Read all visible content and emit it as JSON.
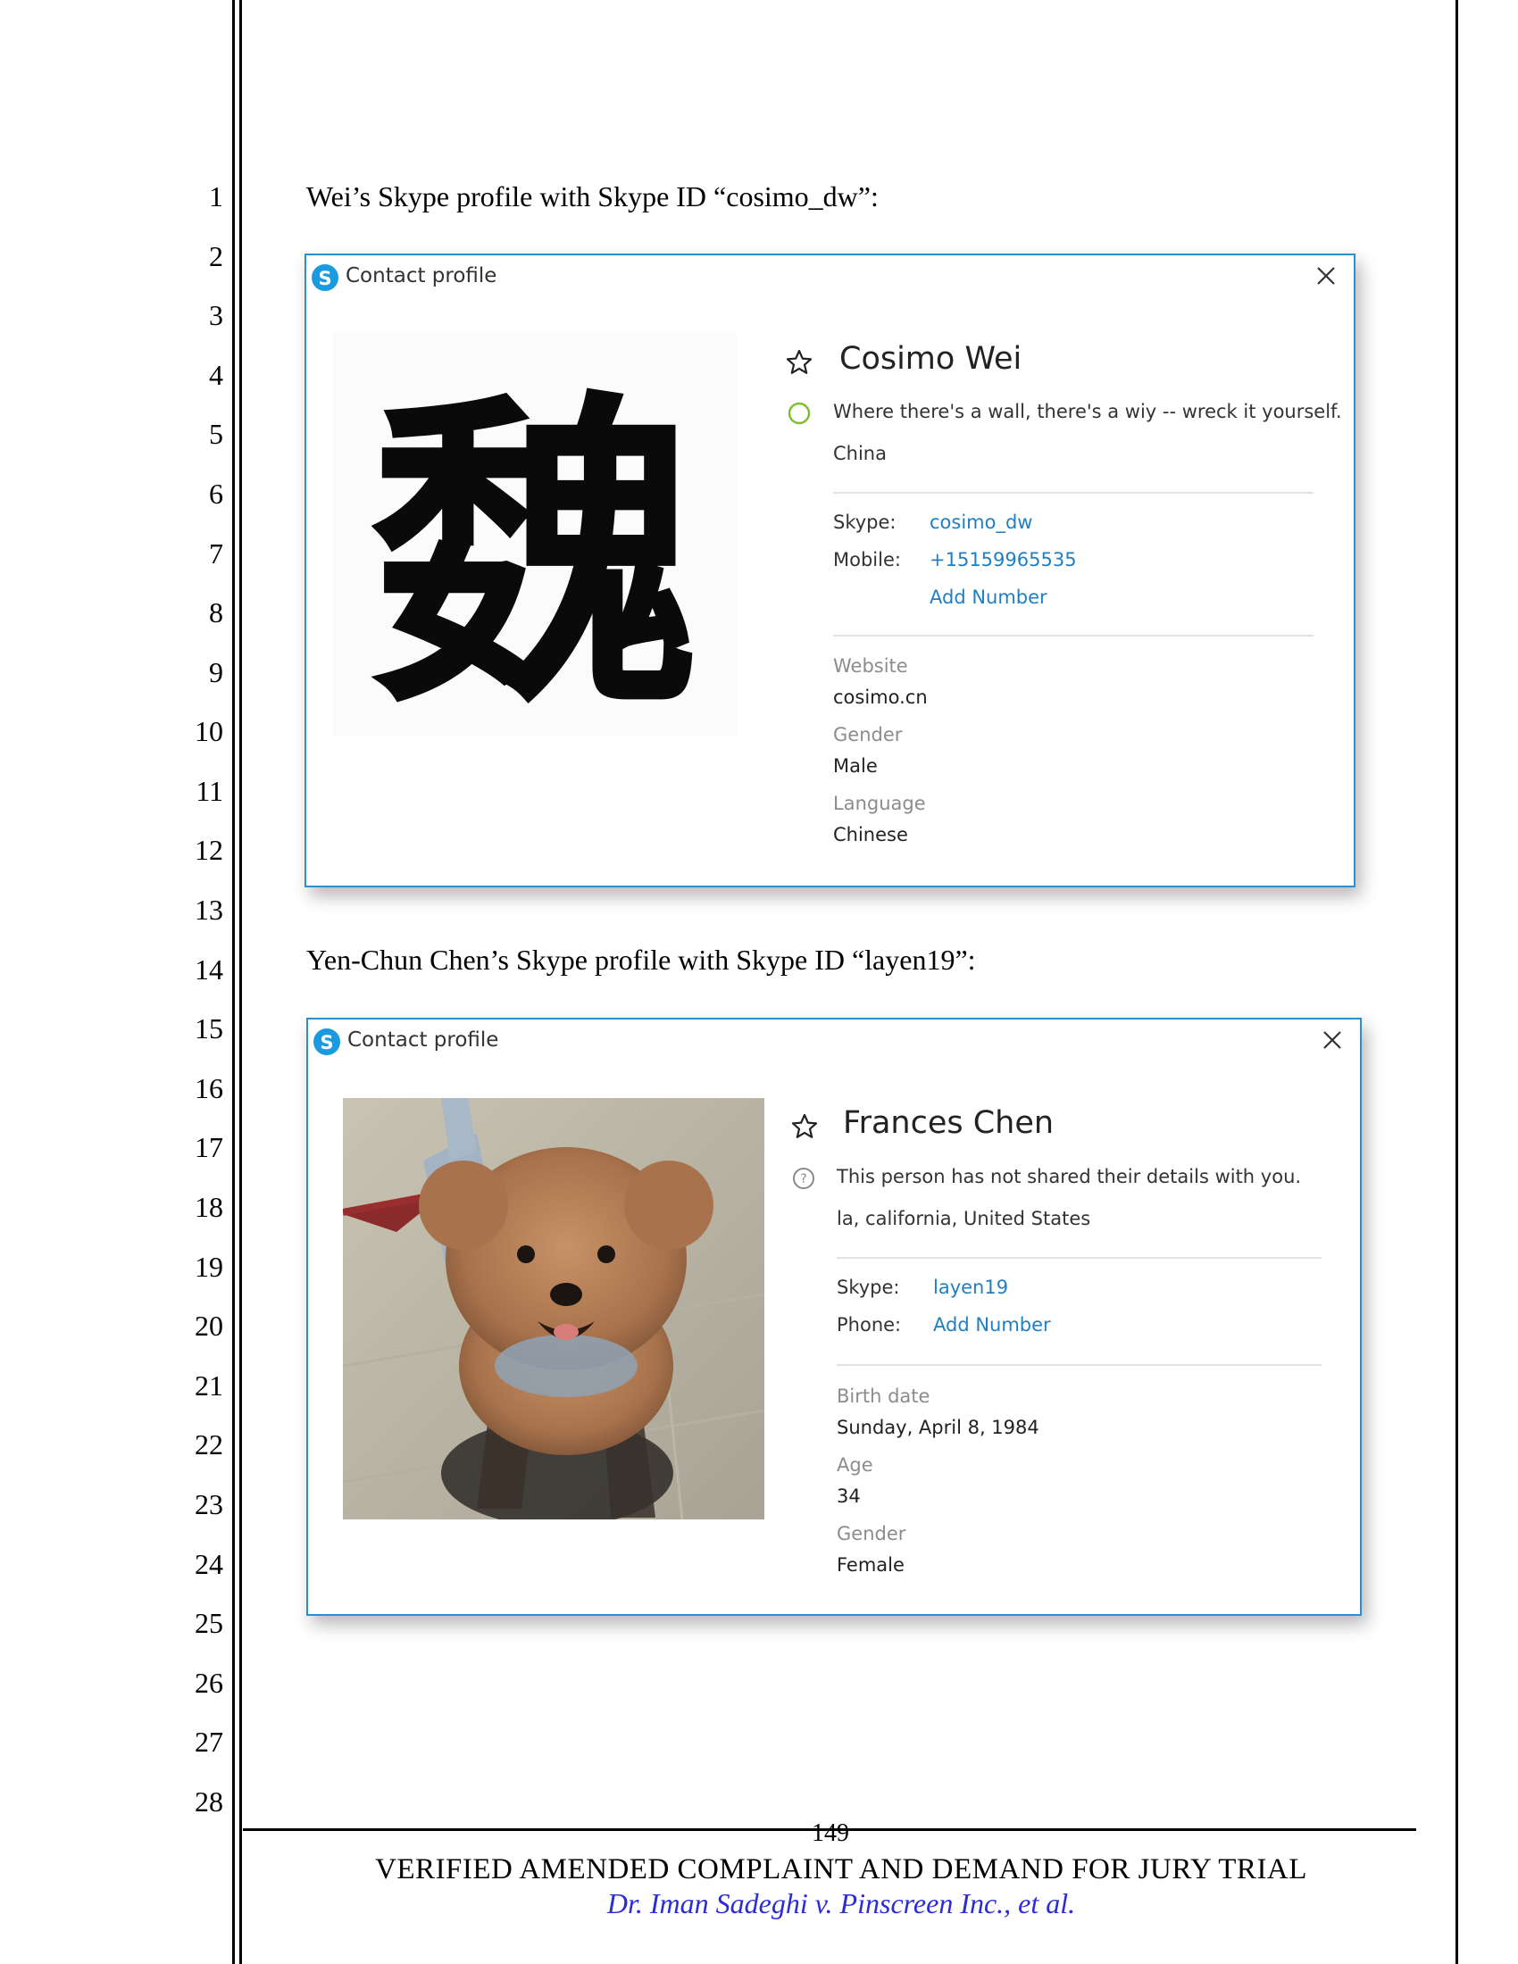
{
  "line_numbers": [
    "1",
    "2",
    "3",
    "4",
    "5",
    "6",
    "7",
    "8",
    "9",
    "10",
    "11",
    "12",
    "13",
    "14",
    "15",
    "16",
    "17",
    "18",
    "19",
    "20",
    "21",
    "22",
    "23",
    "24",
    "25",
    "26",
    "27",
    "28"
  ],
  "captions": [
    "Wei’s Skype profile with Skype ID “cosimo_dw”:",
    "Yen-Chun Chen’s Skype profile with Skype ID “layen19”:"
  ],
  "profile1": {
    "window_title": "Contact profile",
    "avatar_glyph": "魏",
    "name": "Cosimo Wei",
    "mood": "Where there's a wall, there's a wiy -- wreck it yourself.",
    "location": "China",
    "skype_label": "Skype:",
    "skype_value": "cosimo_dw",
    "mobile_label": "Mobile:",
    "mobile_value": "+15159965535",
    "add_number": "Add Number",
    "website_label": "Website",
    "website_value": "cosimo.cn",
    "gender_label": "Gender",
    "gender_value": "Male",
    "language_label": "Language",
    "language_value": "Chinese"
  },
  "profile2": {
    "window_title": "Contact profile",
    "name": "Frances Chen",
    "mood": "This person has not shared their details with you.",
    "location": "la, california, United States",
    "skype_label": "Skype:",
    "skype_value": "layen19",
    "phone_label": "Phone:",
    "add_number": "Add Number",
    "birth_label": "Birth date",
    "birth_value": "Sunday, April 8, 1984",
    "age_label": "Age",
    "age_value": "34",
    "gender_label": "Gender",
    "gender_value": "Female"
  },
  "footer": {
    "page_number": "149",
    "title": "VERIFIED AMENDED COMPLAINT AND DEMAND FOR JURY TRIAL",
    "case": "Dr. Iman Sadeghi v. Pinscreen Inc., et al."
  },
  "colors": {
    "dialog_border": "#2e8fd0",
    "link": "#1f7fc4",
    "status_online": "#7cbd2a",
    "case_caption": "#2b2bd9"
  }
}
